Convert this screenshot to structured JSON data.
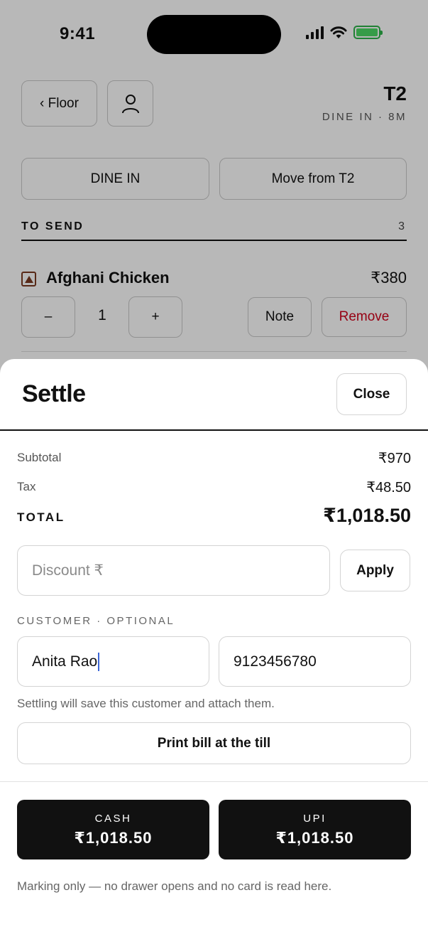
{
  "status_bar": {
    "time": "9:41"
  },
  "header": {
    "back_label": "‹ Floor",
    "table": "T2",
    "subtitle": "DINE IN · 8M"
  },
  "actions": {
    "dine_in": "DINE IN",
    "move": "Move from T2"
  },
  "section": {
    "label": "TO SEND",
    "count": "3"
  },
  "item": {
    "name": "Afghani Chicken",
    "price": "₹380",
    "minus": "–",
    "quantity": "1",
    "plus": "+",
    "note": "Note",
    "remove": "Remove"
  },
  "settle": {
    "title": "Settle",
    "close": "Close",
    "subtotal_label": "Subtotal",
    "subtotal_value": "₹970",
    "tax_label": "Tax",
    "tax_value": "₹48.50",
    "total_label": "TOTAL",
    "total_value": "₹1,018.50",
    "discount_placeholder": "Discount ₹",
    "apply": "Apply",
    "customer_label": "CUSTOMER · OPTIONAL",
    "customer_name": "Anita Rao",
    "customer_phone": "9123456780",
    "hint": "Settling will save this customer and attach them.",
    "print": "Print bill at the till",
    "cash_label": "CASH",
    "cash_amount": "₹1,018.50",
    "upi_label": "UPI",
    "upi_amount": "₹1,018.50",
    "footnote": "Marking only — no drawer opens and no card is read here."
  },
  "colors": {
    "primary_button": "#111111",
    "remove_text": "#d0021b",
    "caret": "#3b66d6",
    "battery": "#4cd964"
  }
}
